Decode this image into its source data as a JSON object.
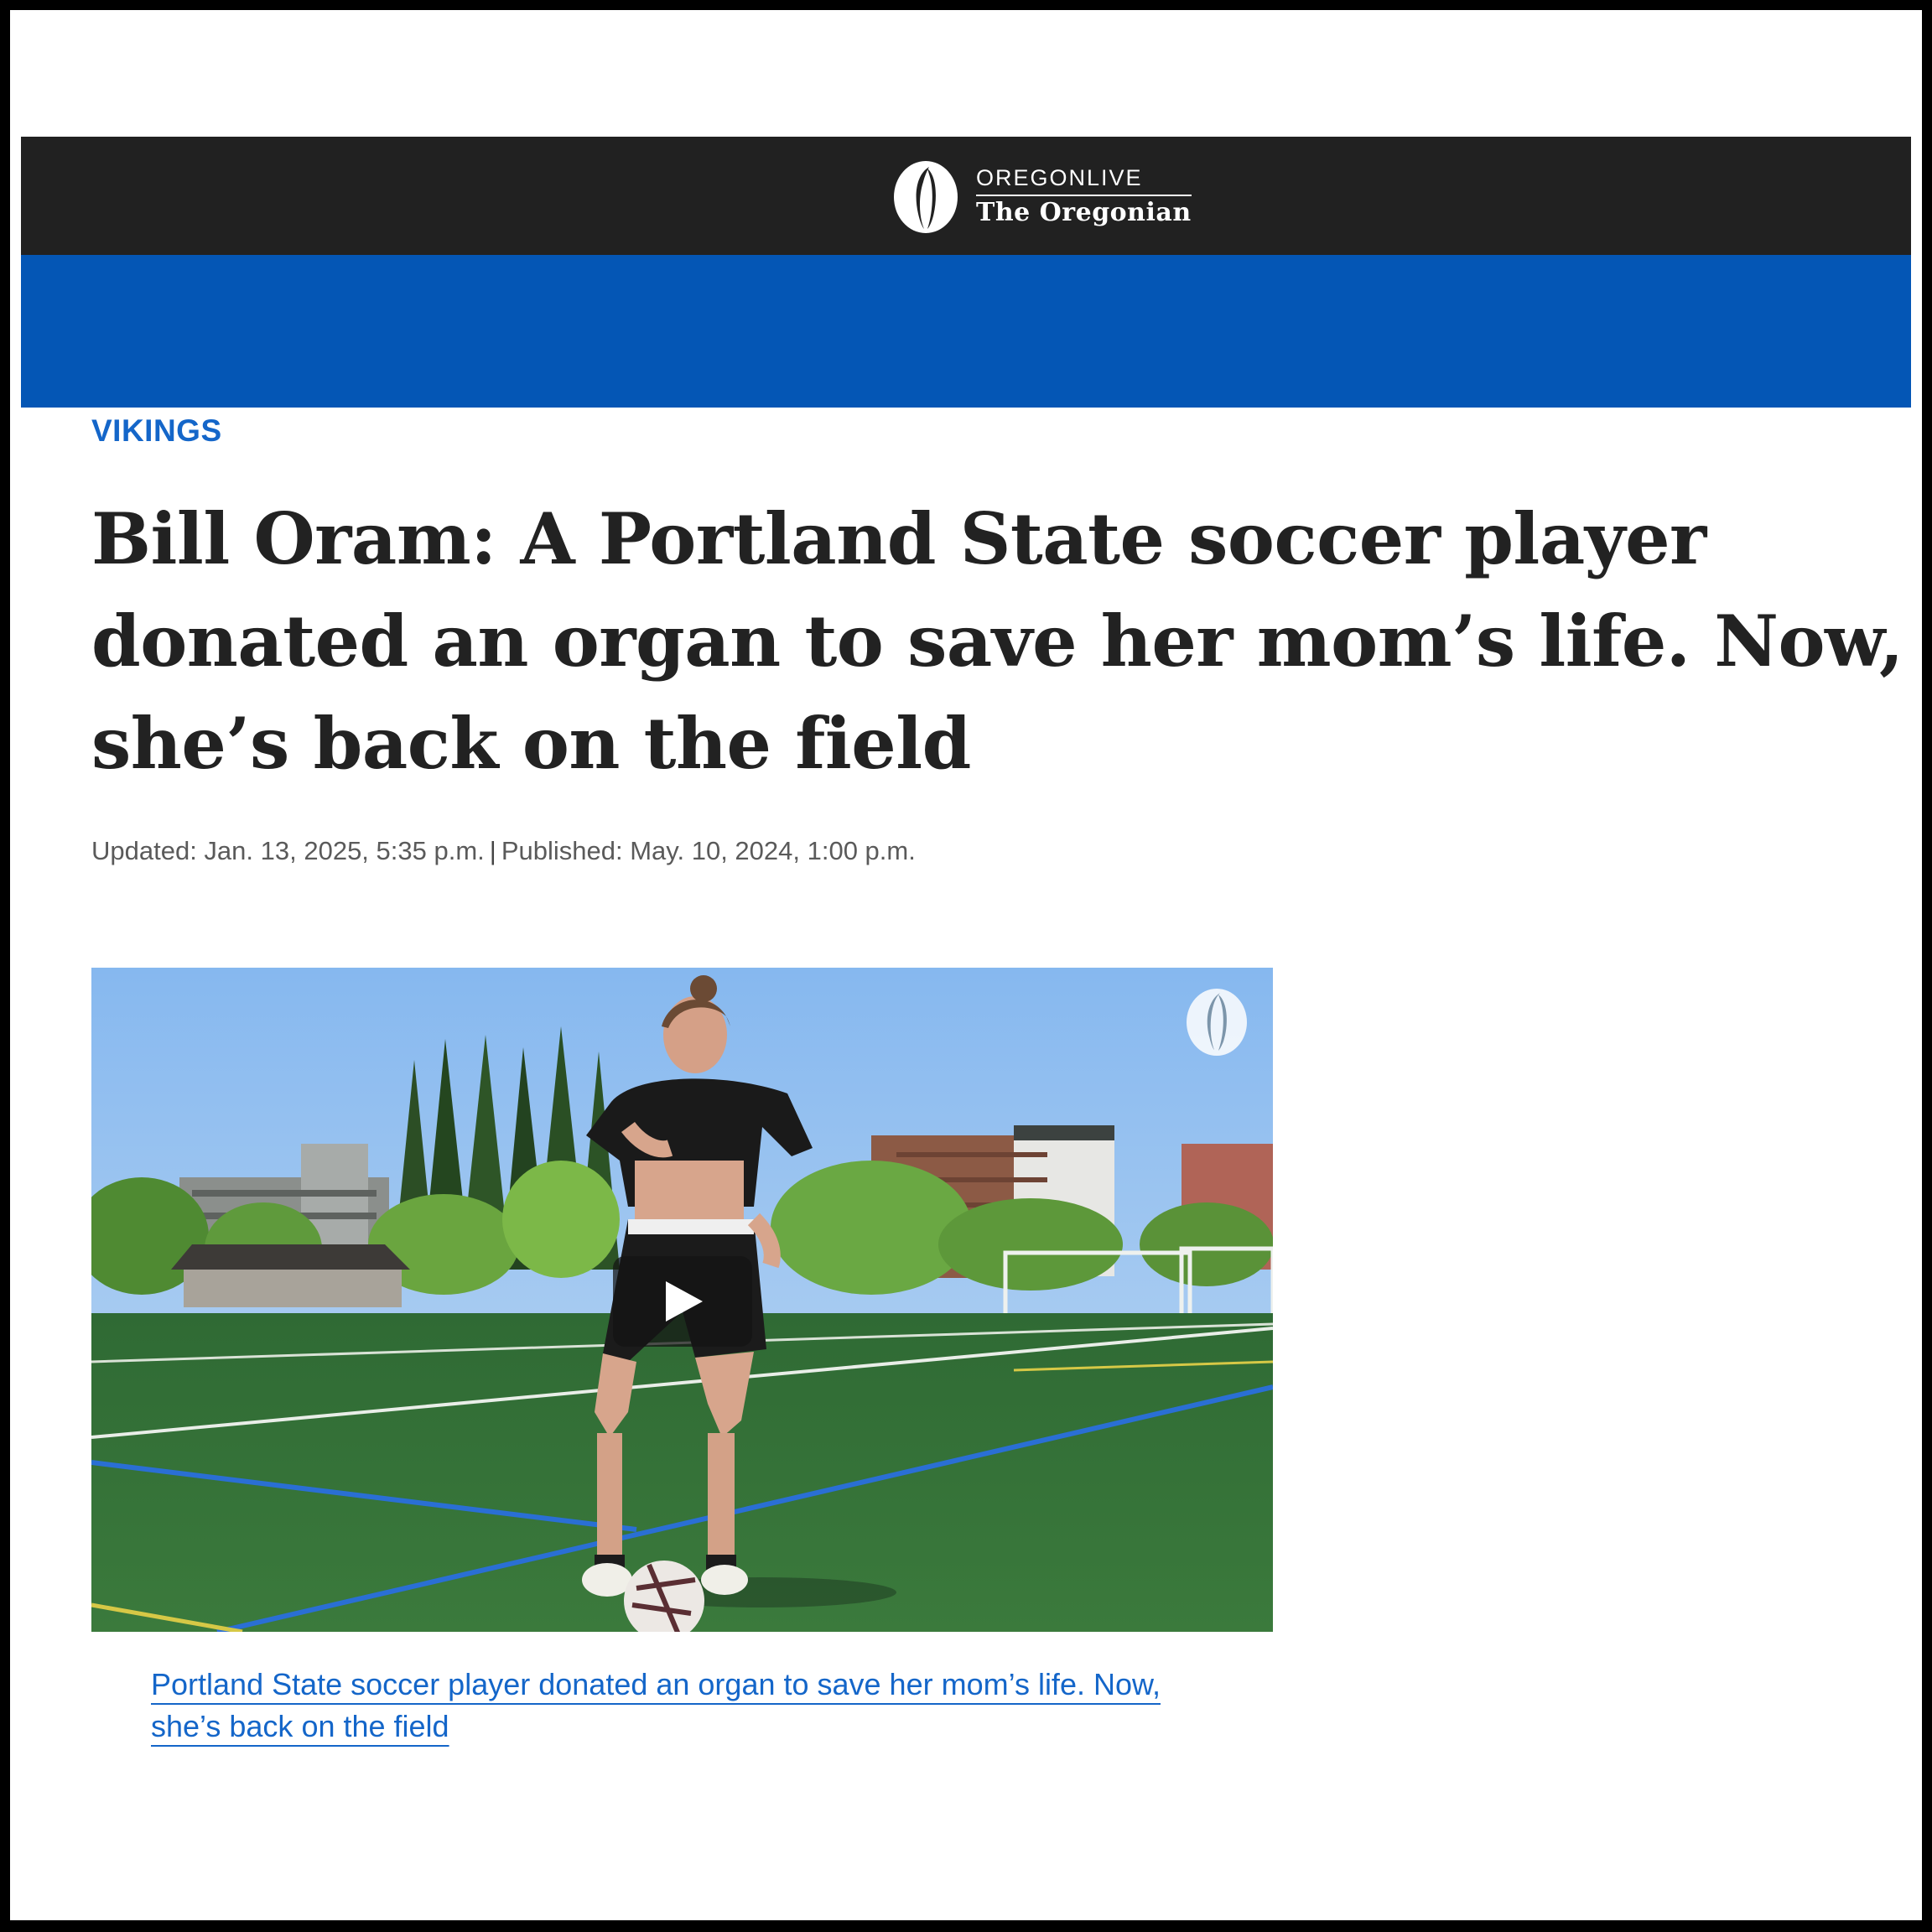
{
  "header": {
    "logo_top": "OREGONLIVE",
    "logo_bottom": "The Oregonian",
    "logo_icon": "oregonian-o-logo-icon",
    "bar_color": "#212121",
    "band_color": "#0456b5"
  },
  "article": {
    "section": "VIKINGS",
    "headline": "Bill Oram: A Portland State soccer player donated an organ to save her mom’s life. Now, she’s back on the field",
    "updated": "Updated: Jan. 13, 2025, 5:35 p.m.",
    "published": "Published: May. 10, 2024, 1:00 p.m.",
    "meta_separator": "|",
    "accent_color": "#1466c9"
  },
  "video": {
    "play_icon": "play-icon",
    "watermark_icon": "oregonian-o-watermark-icon",
    "caption": "Portland State soccer player donated an organ to save her mom’s life. Now, she’s back on the field"
  }
}
